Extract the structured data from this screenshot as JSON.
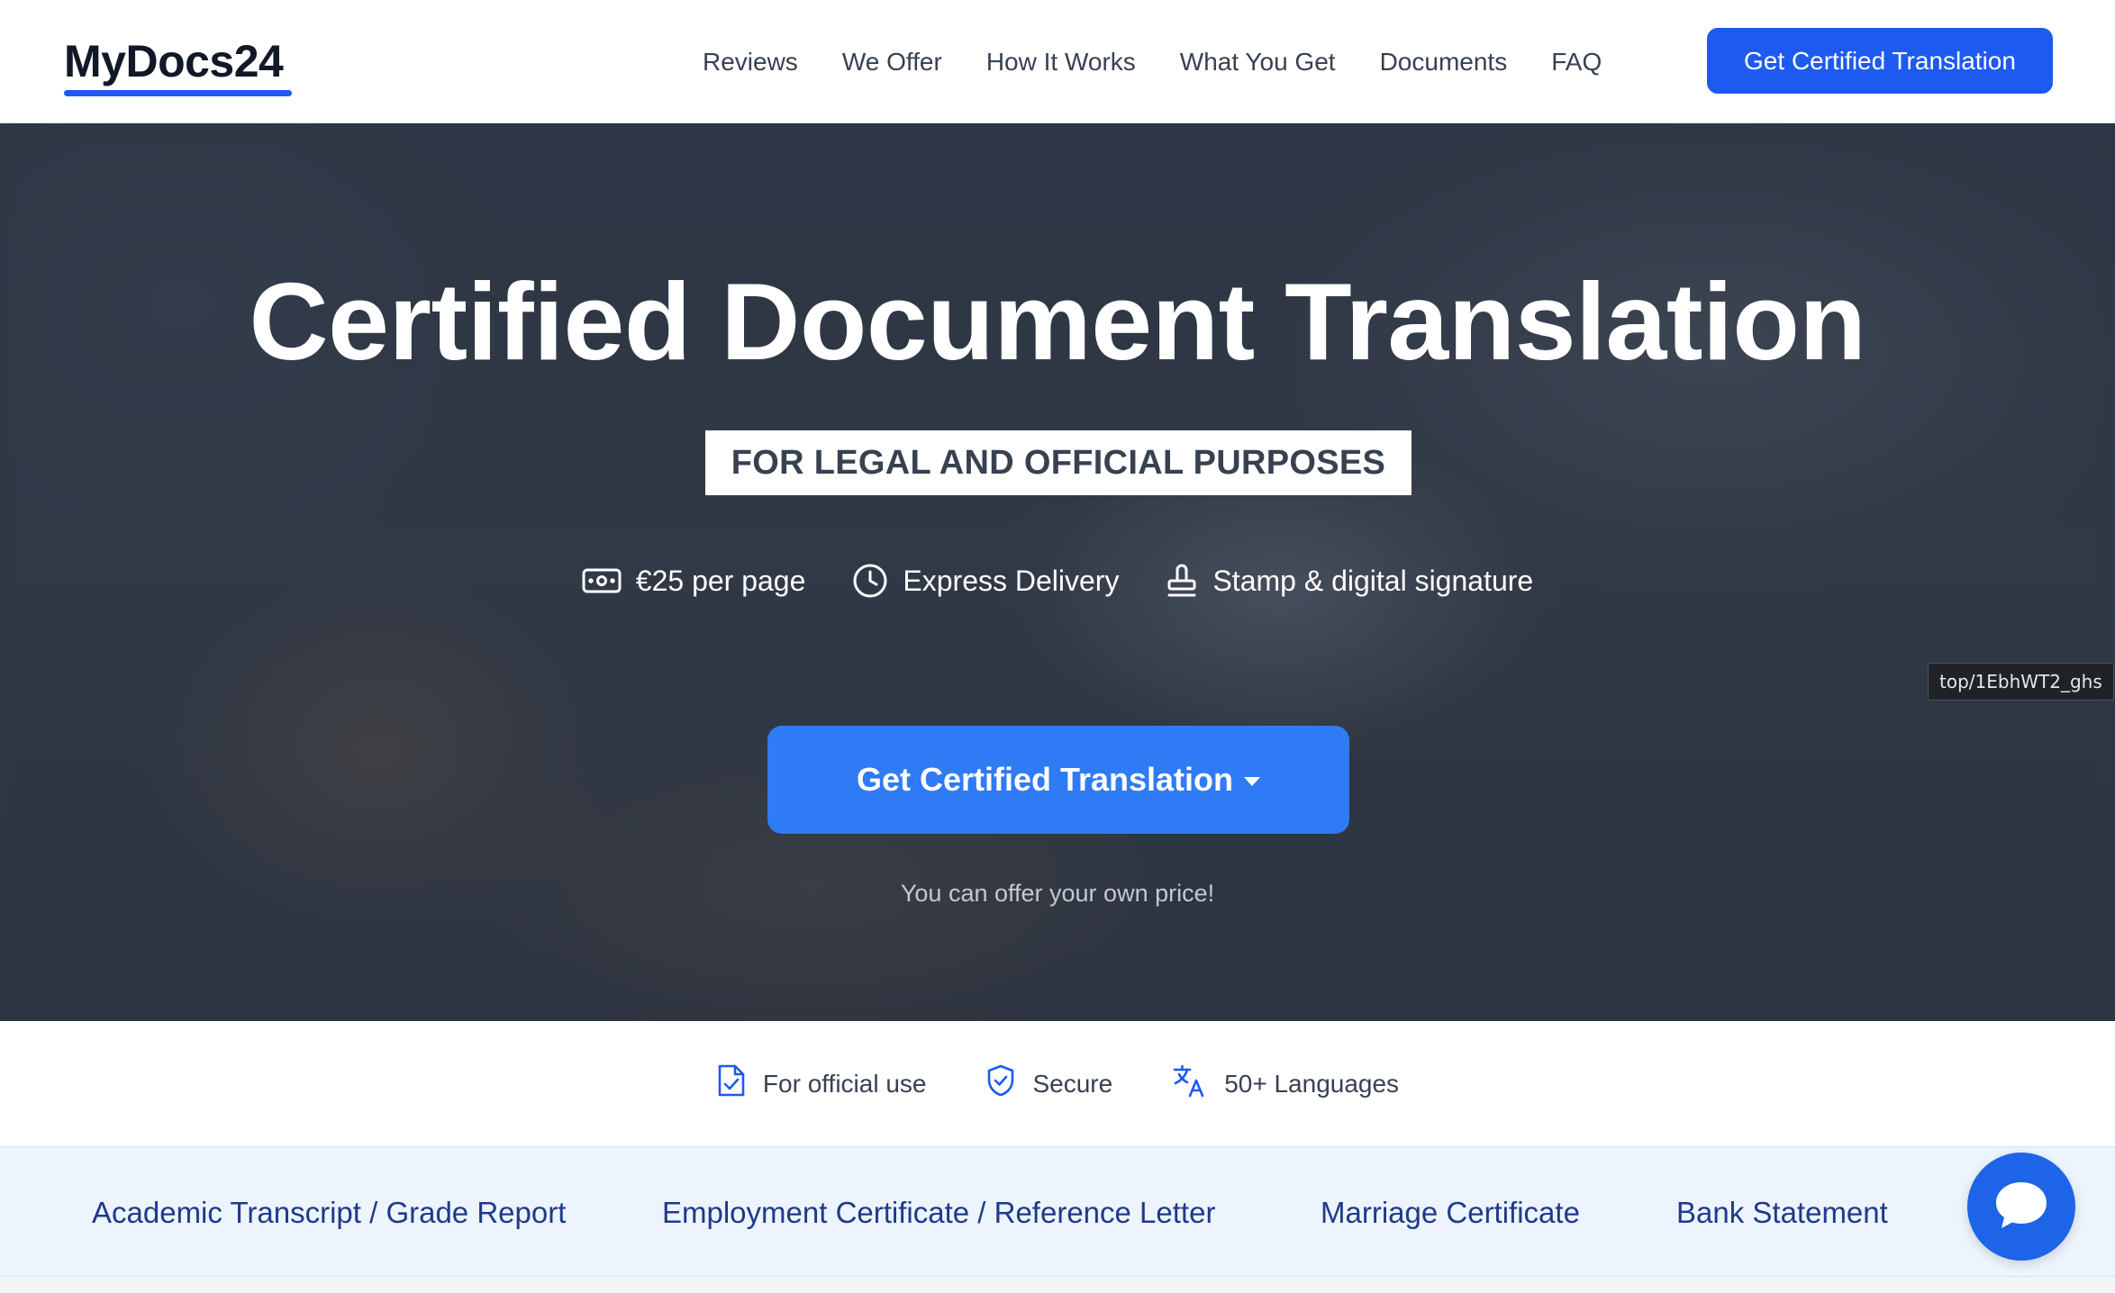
{
  "brand": {
    "logo_text": "MyDocs24",
    "accent_color": "#1d5bf0"
  },
  "nav": {
    "links": [
      "Reviews",
      "We Offer",
      "How It Works",
      "What You Get",
      "Documents",
      "FAQ"
    ],
    "cta_label": "Get Certified Translation"
  },
  "hero": {
    "title": "Certified Document Translation",
    "badge": "FOR LEGAL AND OFFICIAL PURPOSES",
    "features": [
      {
        "icon": "banknote-icon",
        "label": "€25 per page"
      },
      {
        "icon": "clock-icon",
        "label": "Express Delivery"
      },
      {
        "icon": "stamp-icon",
        "label": "Stamp & digital signature"
      }
    ],
    "cta_label": "Get Certified Translation",
    "note": "You can offer your own price!"
  },
  "url_tooltip": "top/1EbhWT2_ghs",
  "trust": [
    {
      "icon": "document-check-icon",
      "label": "For official use"
    },
    {
      "icon": "shield-check-icon",
      "label": "Secure"
    },
    {
      "icon": "translate-icon",
      "label": "50+ Languages"
    }
  ],
  "documents": [
    "Academic Transcript / Grade Report",
    "Employment Certificate / Reference Letter",
    "Marriage Certificate",
    "Bank Statement"
  ],
  "chat": {
    "icon": "chat-bubble-icon",
    "color": "#1d64e8"
  }
}
